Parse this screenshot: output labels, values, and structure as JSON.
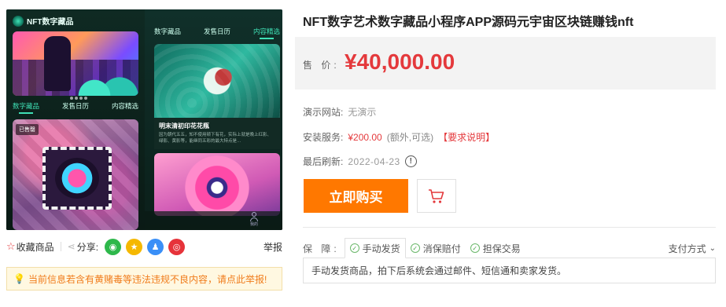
{
  "gallery": {
    "app_title": "NFT数字藏品",
    "left_tabs": [
      "数字藏品",
      "发售日历",
      "内容精选"
    ],
    "right_tabs": [
      "数字藏品",
      "发售日历",
      "内容精选"
    ],
    "badge": "已售罄",
    "card_title": "明末清初印花花瓶",
    "card_desc": "因为朝代五五，知不使用顿下有花，实际上就是晚上红影、绿影、黄影等，能继同五彩的最大特点是…",
    "nav_label": "我的"
  },
  "share": {
    "fav_label": "收藏商品",
    "share_label": "分享:",
    "report_label": "举报",
    "icons": [
      "wechat-icon",
      "qzone-icon",
      "qq-icon",
      "weibo-icon"
    ]
  },
  "warning": {
    "text": "当前信息若含有黄赌毒等违法违规不良内容，请点此举报!"
  },
  "product": {
    "title": "NFT数字艺术数字藏品小程序APP源码元宇宙区块链赚钱nft",
    "price_label": "售 价:",
    "price": "¥40,000.00"
  },
  "details": {
    "demo_label": "演示网站:",
    "demo_value": "无演示",
    "install_label": "安装服务:",
    "install_price": "¥200.00",
    "install_note": "(额外,可选)",
    "install_link": "【要求说明】",
    "refresh_label": "最后刷新:",
    "refresh_date": "2022-04-23"
  },
  "actions": {
    "buy_label": "立即购买"
  },
  "guarantee": {
    "label": "保 障:",
    "tags": [
      "手动发货",
      "消保赔付",
      "担保交易"
    ],
    "pay_label": "支付方式",
    "desc": "手动发货商品，拍下后系统会通过邮件、短信通和卖家发货。"
  },
  "colors": {
    "accent": "#ff7800",
    "price": "#e4393c",
    "warning_bg": "#fff8e1"
  }
}
